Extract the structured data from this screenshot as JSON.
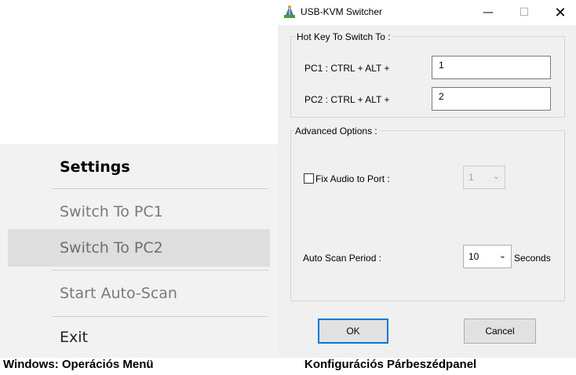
{
  "menu": {
    "items": [
      {
        "label": "Settings",
        "state": "default"
      },
      {
        "label": "Switch To PC1",
        "state": "disabled"
      },
      {
        "label": "Switch To PC2",
        "state": "highlighted"
      },
      {
        "label": "Start Auto-Scan",
        "state": "disabled"
      },
      {
        "label": "Exit",
        "state": "normal"
      }
    ]
  },
  "dialog": {
    "title": "USB-KVM Switcher",
    "window_controls": {
      "minimize": "—",
      "maximize": "☐",
      "close": "✕"
    },
    "hotkey_group": {
      "label": "Hot Key To Switch To :",
      "pc1_label": "PC1 : CTRL + ALT +",
      "pc1_value": "1",
      "pc2_label": "PC2 : CTRL + ALT +",
      "pc2_value": "2"
    },
    "advanced_group": {
      "label": "Advanced Options :",
      "fix_audio_label": "Fix Audio to Port :",
      "fix_audio_checked": false,
      "fix_audio_port": "1",
      "auto_scan_label": "Auto Scan Period :",
      "auto_scan_value": "10",
      "auto_scan_unit": "Seconds"
    },
    "ok_label": "OK",
    "cancel_label": "Cancel",
    "colors": {
      "default_button_border": "#0078d7",
      "dialog_bg": "#f0f0f0"
    },
    "icons": {
      "app_icon": "usb-kvm-icon",
      "dropdown": "chevron-down-icon"
    }
  },
  "captions": {
    "left": "Windows: Operációs Menü",
    "right": "Konfigurációs Párbeszédpanel"
  }
}
